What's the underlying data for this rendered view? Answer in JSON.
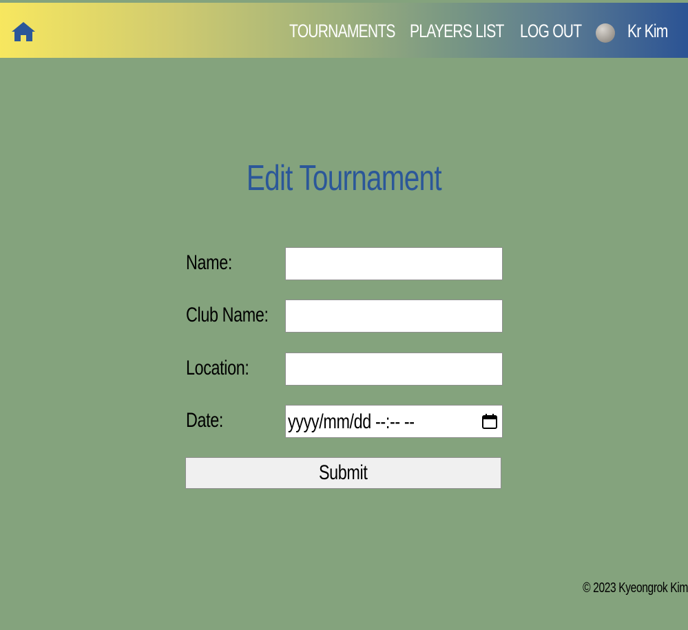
{
  "nav": {
    "links": {
      "tournaments": "TOURNAMENTS",
      "players_list": "PLAYERS LIST",
      "log_out": "LOG OUT"
    },
    "user_name": "Kr Kim",
    "home_icon": "home-icon",
    "avatar_icon": "avatar"
  },
  "page": {
    "title": "Edit Tournament"
  },
  "form": {
    "name_label": "Name:",
    "name_value": "",
    "club_name_label": "Club Name:",
    "club_name_value": "",
    "location_label": "Location:",
    "location_value": "",
    "date_label": "Date:",
    "date_placeholder": "yyyy/mm/dd --:-- --",
    "submit_label": "Submit"
  },
  "footer": {
    "copyright": "© 2023 Kyeongrok Kim"
  },
  "colors": {
    "background": "#84a37d",
    "title": "#2b5799",
    "nav_gradient_start": "#f7e75f",
    "nav_gradient_end": "#2b5394",
    "home_icon": "#2b5799"
  }
}
